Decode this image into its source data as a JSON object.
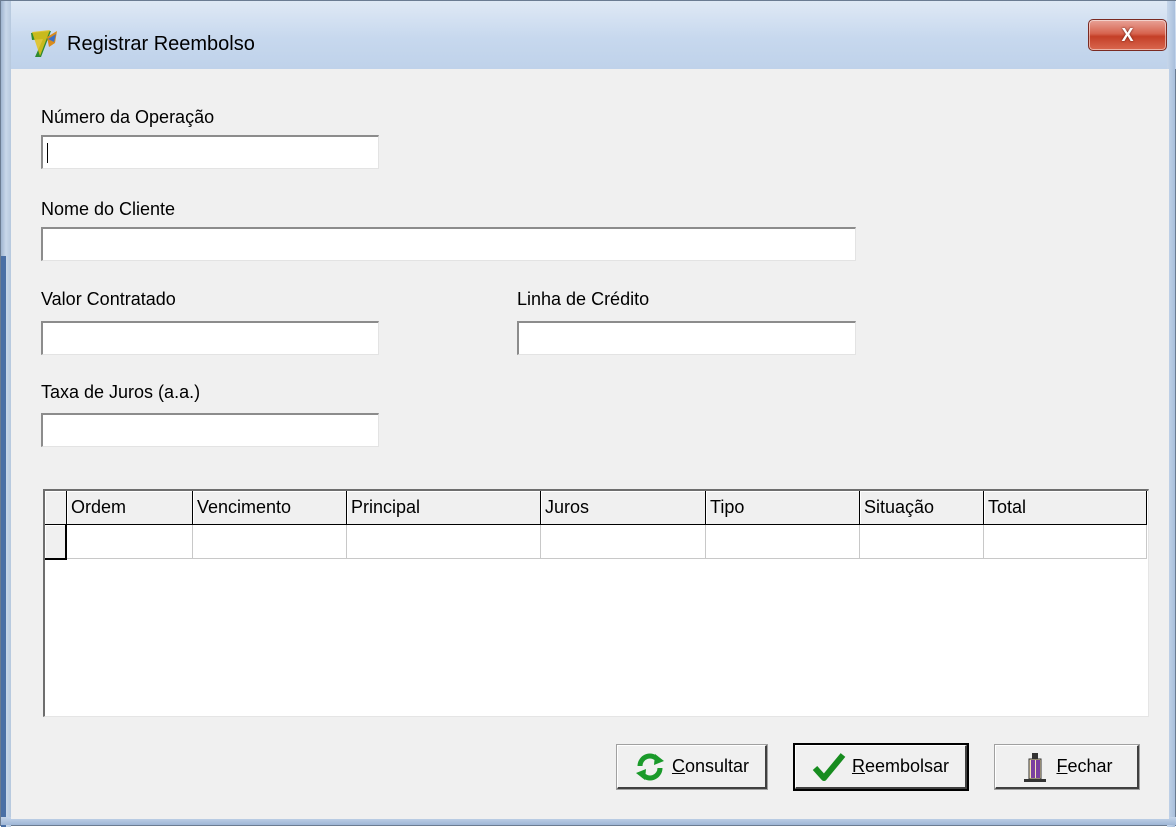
{
  "window": {
    "title": "Registrar Reembolso",
    "close_label": "X"
  },
  "form": {
    "numero_operacao": {
      "label": "Número da Operação",
      "value": ""
    },
    "nome_cliente": {
      "label": "Nome do Cliente",
      "value": ""
    },
    "valor_contratado": {
      "label": "Valor Contratado",
      "value": ""
    },
    "linha_credito": {
      "label": "Linha de Crédito",
      "value": ""
    },
    "taxa_juros": {
      "label": "Taxa de Juros (a.a.)",
      "value": ""
    }
  },
  "grid": {
    "columns": [
      "Ordem",
      "Vencimento",
      "Principal",
      "Juros",
      "Tipo",
      "Situação",
      "Total"
    ],
    "rows": [
      [
        "",
        "",
        "",
        "",
        "",
        "",
        ""
      ]
    ]
  },
  "buttons": {
    "consultar": {
      "mnemonic": "C",
      "rest": "onsultar",
      "icon": "refresh-icon",
      "icon_color": "#1a9a2a"
    },
    "reembolsar": {
      "mnemonic": "R",
      "rest": "eembolsar",
      "icon": "checkmark-icon",
      "icon_color": "#178c1f"
    },
    "fechar": {
      "mnemonic": "F",
      "rest": "echar",
      "icon": "exit-door-icon",
      "icon_color": "#7a3fa0"
    }
  },
  "colors": {
    "titlebar": "#c7d8ee",
    "close_button": "#c43f27",
    "window_bg": "#f0f0f0"
  }
}
